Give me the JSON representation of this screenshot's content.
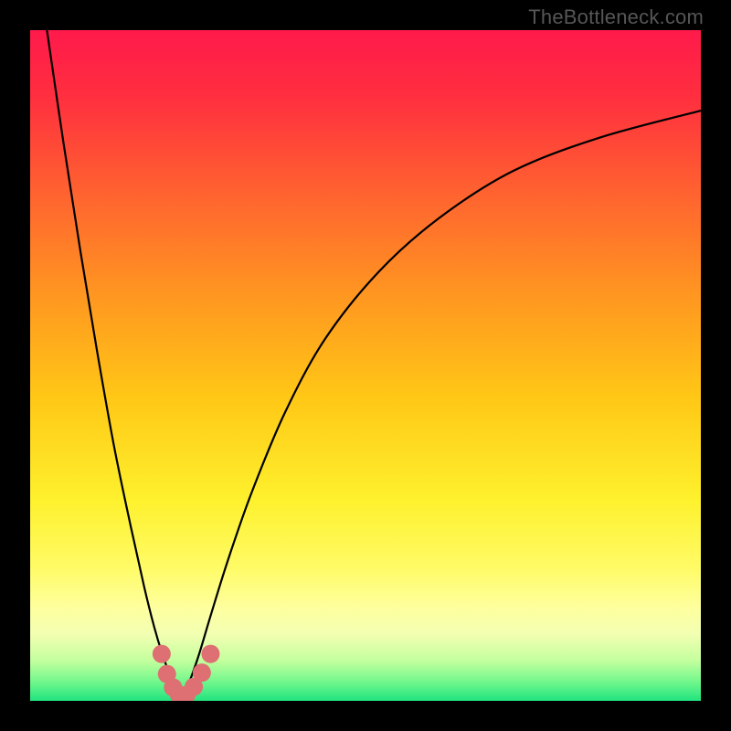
{
  "watermark": "TheBottleneck.com",
  "gradient": {
    "stops": [
      {
        "offset": 0.0,
        "color": "#ff1a4b"
      },
      {
        "offset": 0.1,
        "color": "#ff2f3f"
      },
      {
        "offset": 0.25,
        "color": "#ff652f"
      },
      {
        "offset": 0.4,
        "color": "#ff9820"
      },
      {
        "offset": 0.55,
        "color": "#ffc816"
      },
      {
        "offset": 0.7,
        "color": "#fef12d"
      },
      {
        "offset": 0.8,
        "color": "#fffb65"
      },
      {
        "offset": 0.86,
        "color": "#feff9d"
      },
      {
        "offset": 0.9,
        "color": "#f3ffb2"
      },
      {
        "offset": 0.94,
        "color": "#c4ff9e"
      },
      {
        "offset": 0.97,
        "color": "#76f88d"
      },
      {
        "offset": 1.0,
        "color": "#21e47f"
      }
    ]
  },
  "chart_data": {
    "type": "line",
    "title": "",
    "xlabel": "",
    "ylabel": "",
    "xlim": [
      0,
      100
    ],
    "ylim": [
      0,
      100
    ],
    "grid": false,
    "series": [
      {
        "name": "curve-left",
        "x": [
          2.5,
          5,
          7.5,
          10,
          12.5,
          15,
          17.0,
          18.5,
          19.7,
          20.8,
          21.8,
          22.7
        ],
        "values": [
          100,
          83,
          67,
          52,
          38,
          26,
          17,
          11,
          7,
          4,
          2,
          0.7
        ]
      },
      {
        "name": "curve-right",
        "x": [
          22.7,
          23.8,
          25.2,
          27,
          29.5,
          33,
          38,
          44,
          52,
          61,
          72,
          85,
          100
        ],
        "values": [
          0.7,
          3,
          7,
          13,
          21,
          31,
          43,
          54,
          64,
          72,
          79,
          84,
          88
        ]
      }
    ],
    "markers": {
      "name": "valley-dots",
      "color": "#de6f72",
      "radius": 10,
      "x": [
        19.6,
        20.4,
        21.3,
        22.2,
        23.3,
        24.4,
        25.6,
        26.9
      ],
      "values": [
        7.0,
        4.0,
        2.0,
        0.9,
        0.9,
        2.1,
        4.2,
        7.0
      ]
    }
  }
}
